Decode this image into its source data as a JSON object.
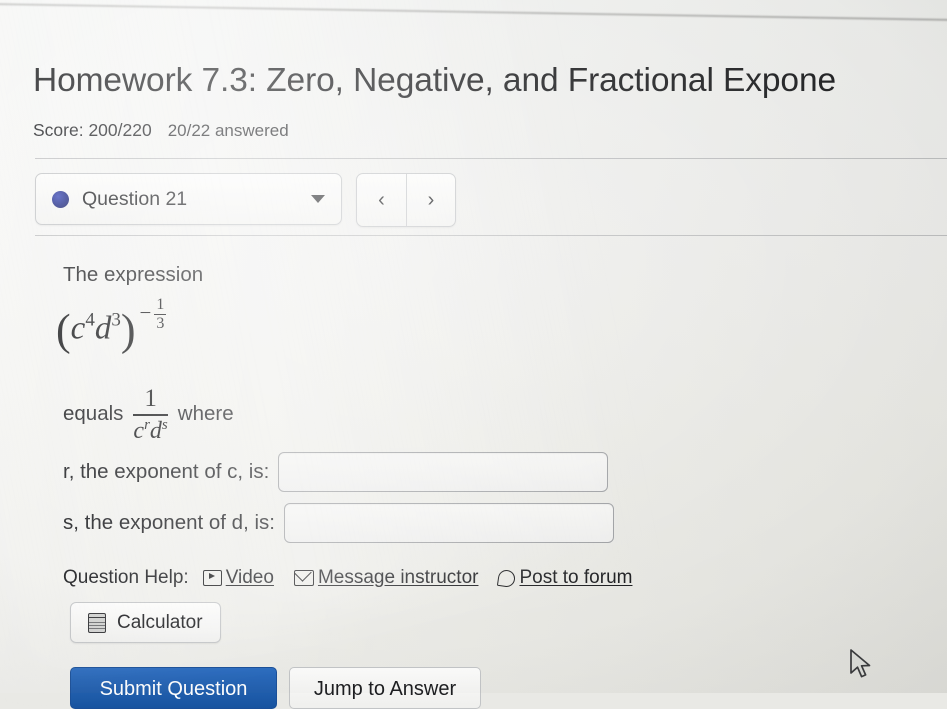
{
  "header": {
    "title": "Homework 7.3: Zero, Negative, and Fractional Expone",
    "score_label": "Score: 200/220",
    "answered_label": "20/22 answered"
  },
  "nav": {
    "question_label": "Question 21",
    "status_dot_color": "#1f2b86",
    "dropdown_icon": "chevron-down-icon",
    "prev_label": "‹",
    "next_label": "›"
  },
  "question": {
    "intro": "The expression",
    "expression": {
      "open_paren": "(",
      "base1": "c",
      "base1_exp": "4",
      "base2": "d",
      "base2_exp": "3",
      "close_paren": ")",
      "outer_sign": "−",
      "outer_num": "1",
      "outer_den": "3",
      "plain": "(c^4 d^3)^(-1/3)"
    },
    "equals_word": "equals",
    "result_fraction": {
      "numerator": "1",
      "den_base1": "c",
      "den_exp1": "r",
      "den_base2": "d",
      "den_exp2": "s",
      "plain": "1/(c^r d^s)"
    },
    "where_word": "where",
    "fields": [
      {
        "label": "r, the exponent of c, is:",
        "value": "",
        "placeholder": ""
      },
      {
        "label": "s, the exponent of d, is:",
        "value": "",
        "placeholder": ""
      }
    ]
  },
  "help": {
    "label": "Question Help:",
    "links": [
      {
        "icon": "video-icon",
        "text": "Video"
      },
      {
        "icon": "envelope-icon",
        "text": "Message instructor"
      },
      {
        "icon": "forum-bubble-icon",
        "text": "Post to forum"
      }
    ]
  },
  "tools": {
    "calculator_label": "Calculator",
    "calculator_icon": "calculator-icon"
  },
  "actions": {
    "submit_label": "Submit Question",
    "submit_color": "#1d5fb5",
    "jump_label": "Jump to Answer"
  }
}
